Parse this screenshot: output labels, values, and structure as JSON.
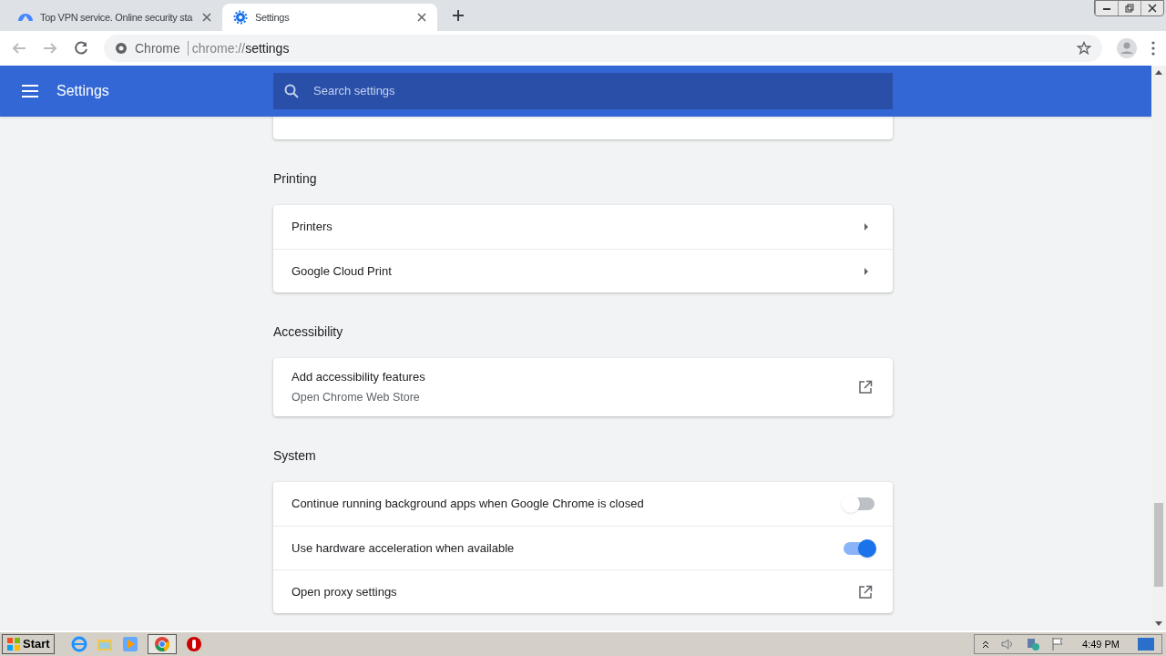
{
  "tabs": [
    {
      "title": "Top VPN service. Online security sta",
      "selected": false
    },
    {
      "title": "Settings",
      "selected": true
    }
  ],
  "address": {
    "site": "Chrome",
    "url_prefix": "chrome://",
    "url_path": "settings"
  },
  "header": {
    "title": "Settings",
    "search_placeholder": "Search settings"
  },
  "sections": [
    {
      "title": "Printing",
      "rows": [
        {
          "kind": "link",
          "label": "Printers"
        },
        {
          "kind": "link",
          "label": "Google Cloud Print"
        }
      ]
    },
    {
      "title": "Accessibility",
      "rows": [
        {
          "kind": "external",
          "label": "Add accessibility features",
          "sublabel": "Open Chrome Web Store"
        }
      ]
    },
    {
      "title": "System",
      "rows": [
        {
          "kind": "toggle",
          "label": "Continue running background apps when Google Chrome is closed",
          "on": false
        },
        {
          "kind": "toggle",
          "label": "Use hardware acceleration when available",
          "on": true
        },
        {
          "kind": "external",
          "label": "Open proxy settings"
        }
      ]
    }
  ],
  "taskbar": {
    "start": "Start",
    "clock": "4:49 PM"
  }
}
